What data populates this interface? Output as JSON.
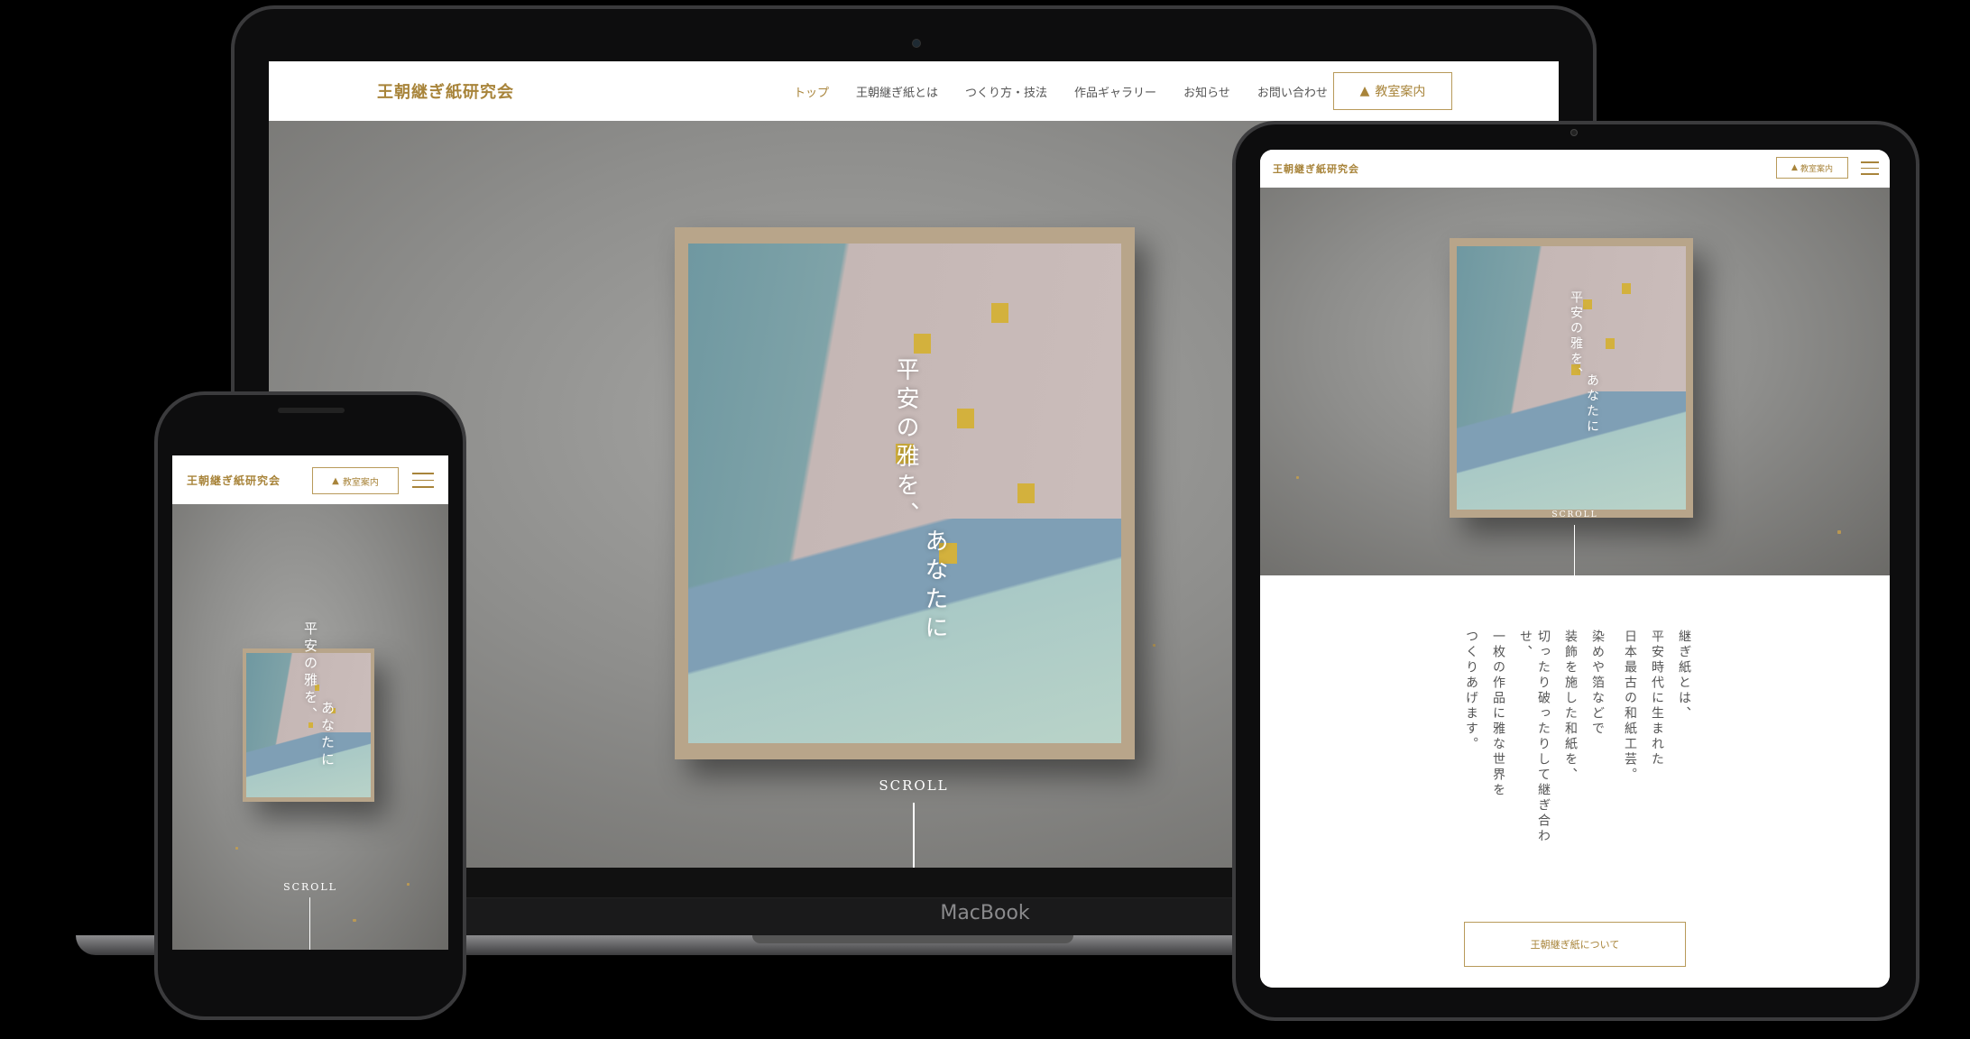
{
  "site": {
    "logo": "王朝継ぎ紙研究会",
    "nav": [
      "トップ",
      "王朝継ぎ紙とは",
      "つくり方・技法",
      "作品ギャラリー",
      "お知らせ",
      "お問い合わせ"
    ],
    "cta_label": "教室案内"
  },
  "hero": {
    "tagline_1": "平安の雅を、",
    "tagline_2": "あなたに",
    "scroll_label": "SCROLL"
  },
  "laptop": {
    "brand": "MacBook"
  },
  "about": {
    "lines": [
      "継ぎ紙とは、",
      "平安時代に生まれた",
      "日本最古の和紙工芸。",
      "染めや箔などで",
      "装飾を施した和紙を、",
      "切ったり破ったりして継ぎ合わせ、",
      "一枚の作品に雅な世界を",
      "つくりあげます。"
    ],
    "button_label": "王朝継ぎ紙について"
  },
  "colors": {
    "accent": "#a8843a",
    "paper_blue": "#6f98a1",
    "paper_pink": "#cbbdbb"
  }
}
